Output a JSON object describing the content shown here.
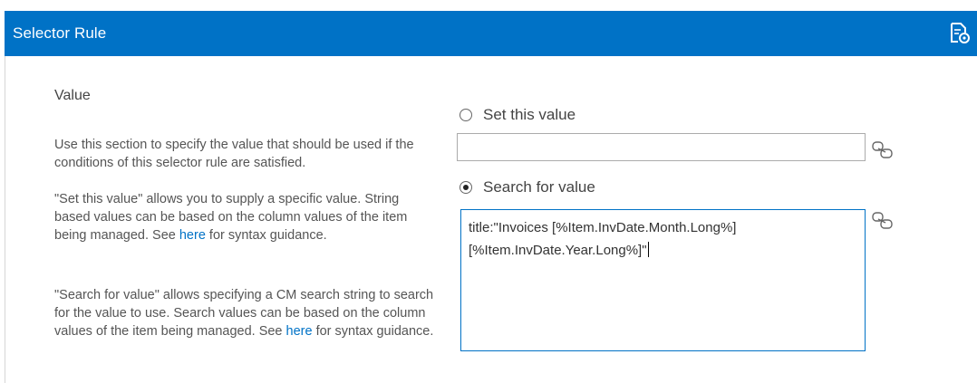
{
  "header": {
    "title": "Selector Rule",
    "icon": "document-settings-icon",
    "accent_color": "#0072c6"
  },
  "section": {
    "title": "Value",
    "paragraph1": "Use this section to specify the value that should be used if the conditions of this selector rule are satisfied.",
    "paragraph2_before": "\"Set this value\" allows you to supply a specific value. String based values can be based on the column values of the item being managed. See ",
    "paragraph2_link": "here",
    "paragraph2_after": " for syntax guidance.",
    "paragraph3_before": "\"Search for value\" allows specifying a CM  search string to search for the value to use. Search values can be based on the column values of the item being managed. See ",
    "paragraph3_link": "here",
    "paragraph3_after": " for syntax guidance."
  },
  "options": {
    "set_value_label": "Set this value",
    "set_value_selected": false,
    "set_value_input": "",
    "search_value_label": "Search for value",
    "search_value_selected": true,
    "search_value_text": "title:\"Invoices [%Item.InvDate.Month.Long%] [%Item.InvDate.Year.Long%]\""
  }
}
